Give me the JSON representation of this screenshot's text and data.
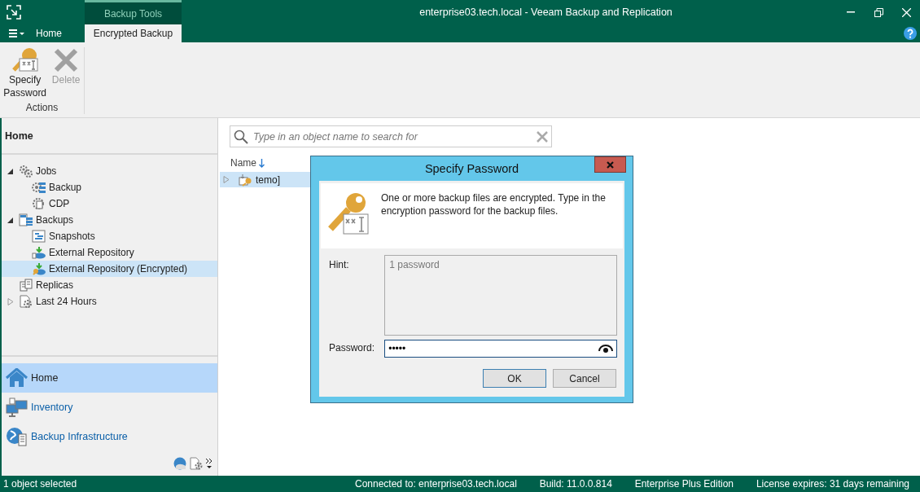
{
  "window": {
    "title": "enterprise03.tech.local - Veeam Backup and Replication"
  },
  "ribbon_tabs": [
    {
      "label": "Home",
      "selected": false
    }
  ],
  "context_group": {
    "label": "Backup Tools",
    "tabs": [
      {
        "label": "Encrypted Backup",
        "selected": true
      }
    ]
  },
  "ribbon": {
    "buttons": [
      {
        "label": "Specify Password",
        "disabled": false
      },
      {
        "label": "Delete",
        "disabled": true
      }
    ],
    "group_label": "Actions"
  },
  "sidebar": {
    "title": "Home",
    "tree": [
      {
        "label": "Jobs",
        "expanded": true,
        "selected": false,
        "children": [
          {
            "label": "Backup",
            "selected": false
          },
          {
            "label": "CDP",
            "selected": false
          }
        ]
      },
      {
        "label": "Backups",
        "expanded": true,
        "selected": false,
        "children": [
          {
            "label": "Snapshots",
            "selected": false
          },
          {
            "label": "External Repository",
            "selected": false
          },
          {
            "label": "External Repository (Encrypted)",
            "selected": true
          }
        ]
      },
      {
        "label": "Replicas",
        "selected": false
      },
      {
        "label": "Last 24 Hours",
        "expanded": false,
        "selected": false
      }
    ],
    "nav": [
      {
        "label": "Home",
        "selected": true
      },
      {
        "label": "Inventory",
        "selected": false
      },
      {
        "label": "Backup Infrastructure",
        "selected": false
      }
    ]
  },
  "search": {
    "placeholder": "Type in an object name to search for"
  },
  "table": {
    "columns": [
      "Name"
    ],
    "rows": [
      {
        "name": "temo]",
        "selected": true,
        "expanded": false
      }
    ]
  },
  "dialog": {
    "title": "Specify Password",
    "message": "One or more backup files are encrypted. Type in the encryption password for the backup files.",
    "hint_label": "Hint:",
    "hint": {
      "value": "1 password"
    },
    "password_label": "Password:",
    "password": "•••••",
    "buttons": [
      "OK",
      "Cancel"
    ]
  },
  "status_bar": {
    "selection": "1 object selected",
    "items": [
      "Connected to: enterprise03.tech.local",
      "Build: 11.0.0.814",
      "Enterprise Plus Edition",
      "License expires: 31 days remaining"
    ]
  }
}
